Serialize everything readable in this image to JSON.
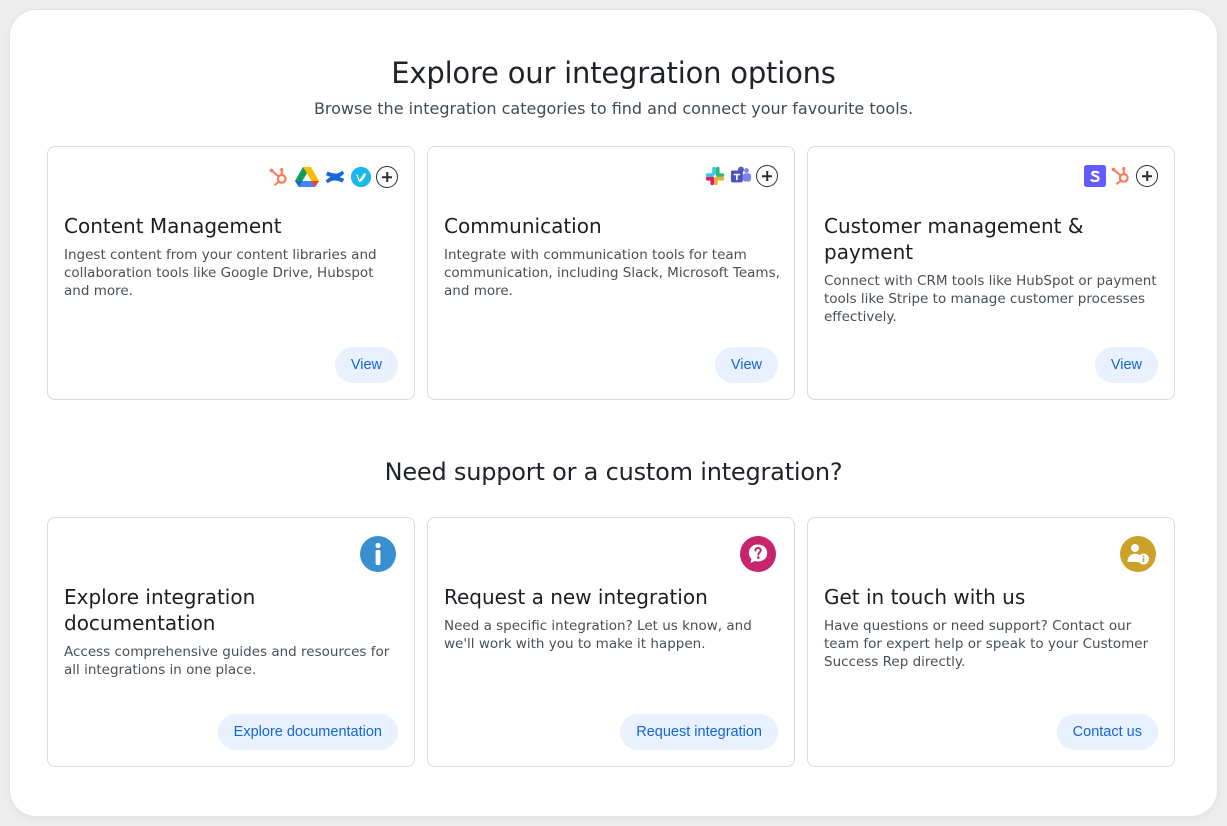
{
  "header": {
    "title": "Explore our integration options",
    "subtitle": "Browse the integration categories to find and connect your favourite tools."
  },
  "categories": [
    {
      "title": "Content Management",
      "description": "Ingest content from your content libraries and collaboration tools like Google Drive, Hubspot and more.",
      "button": "View",
      "icons": [
        "hubspot-icon",
        "google-drive-icon",
        "confluence-icon",
        "vimeo-icon",
        "plus-icon"
      ]
    },
    {
      "title": "Communication",
      "description": "Integrate with communication tools for team communication, including Slack, Microsoft Teams, and more.",
      "button": "View",
      "icons": [
        "slack-icon",
        "microsoft-teams-icon",
        "plus-icon"
      ]
    },
    {
      "title": "Customer management & payment",
      "description": "Connect with CRM tools like HubSpot or payment tools like Stripe to manage customer processes effectively.",
      "button": "View",
      "icons": [
        "stripe-icon",
        "hubspot-icon",
        "plus-icon"
      ]
    }
  ],
  "support": {
    "title": "Need support or a custom integration?",
    "cards": [
      {
        "title": "Explore integration documentation",
        "description": "Access comprehensive guides and resources for all integrations in one place.",
        "button": "Explore documentation",
        "icon": "info-icon",
        "icon_color": "#3a8fd1"
      },
      {
        "title": "Request a new integration",
        "description": "Need a specific integration? Let us know, and we'll work with you to make it happen.",
        "button": "Request integration",
        "icon": "question-chat-icon",
        "icon_color": "#c7256e"
      },
      {
        "title": "Get in touch with us",
        "description": "Have questions or need support? Contact our team for expert help or speak to your Customer Success Rep directly.",
        "button": "Contact us",
        "icon": "person-info-icon",
        "icon_color": "#c9a227"
      }
    ]
  },
  "colors": {
    "button_bg": "#e8f1fd",
    "button_text": "#1267d6",
    "card_border": "#d8dbe0"
  }
}
